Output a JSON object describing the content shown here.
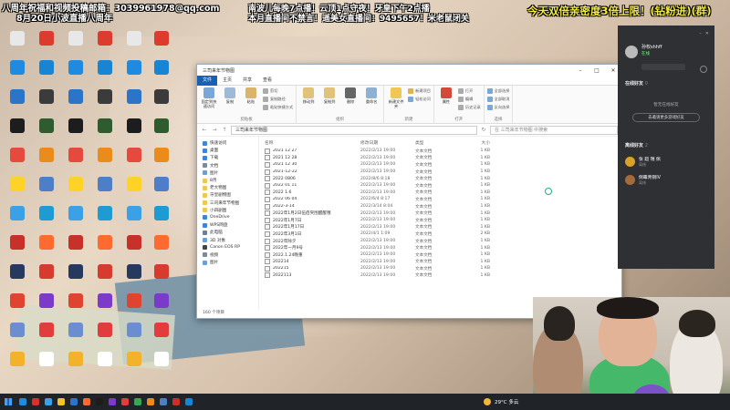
{
  "overlay": {
    "top_left_line1": "八周年祝福和视频投稿邮箱：3039961978@qq.com",
    "top_left_line2": "8月20日小波直播八周年",
    "center_line1": "南波儿每晚7点播！云顶1点守夜！牙皇下午2点播",
    "center_line2": "本月直播间不禁言！遥美女直播间：9495657！米老鼠闭关",
    "top_right": "今天双倍亲密度3倍上限！(钻粉进)(群)"
  },
  "desktop_icons": [
    {
      "label": "",
      "color": "#e8e8e8"
    },
    {
      "label": "",
      "color": "#1e8be0"
    },
    {
      "label": "",
      "color": "#2a74c9"
    },
    {
      "label": "",
      "color": "#1d1d1d"
    },
    {
      "label": "",
      "color": "#e54a3c"
    },
    {
      "label": "",
      "color": "#ffd226"
    },
    {
      "label": "",
      "color": "#3aa0e8"
    },
    {
      "label": "",
      "color": "#c8302a"
    },
    {
      "label": "",
      "color": "#253a5e"
    },
    {
      "label": "",
      "color": "#e0432f"
    },
    {
      "label": "",
      "color": "#6b8ed1"
    },
    {
      "label": "",
      "color": "#f2b22a"
    },
    {
      "label": "",
      "color": "#dd3b2d"
    },
    {
      "label": "",
      "color": "#1785d4"
    },
    {
      "label": "",
      "color": "#3b3b3b"
    },
    {
      "label": "",
      "color": "#2d5c2f"
    },
    {
      "label": "",
      "color": "#ea8c1c"
    },
    {
      "label": "",
      "color": "#4d7ec7"
    },
    {
      "label": "",
      "color": "#1f9bd4"
    },
    {
      "label": "",
      "color": "#ff6a30"
    },
    {
      "label": "",
      "color": "#d63b2d"
    },
    {
      "label": "",
      "color": "#7c3acb"
    },
    {
      "label": "",
      "color": "#e23c3c"
    },
    {
      "label": "",
      "color": "#ffffff"
    }
  ],
  "explorer": {
    "title": "三司来年节物图",
    "tabs": [
      "文件",
      "主页",
      "共享",
      "查看"
    ],
    "ribbon": {
      "clipboard": {
        "label": "剪贴板",
        "pin": "固定到快速访问",
        "copy": "复制",
        "paste": "粘贴",
        "cut": "剪切",
        "copy_path": "复制路径",
        "paste_shortcut": "粘贴快捷方式"
      },
      "organize": {
        "label": "组织",
        "move_to": "移动到",
        "copy_to": "复制到",
        "delete": "删除",
        "rename": "重命名"
      },
      "new": {
        "label": "新建",
        "new_folder": "新建文件夹",
        "new_item": "新建项目",
        "easy_access": "轻松访问"
      },
      "open": {
        "label": "打开",
        "properties": "属性",
        "open": "打开",
        "edit": "编辑",
        "history": "历史记录"
      },
      "select": {
        "label": "选择",
        "select_all": "全部选择",
        "select_none": "全部取消",
        "invert": "反向选择"
      }
    },
    "address": "三司来年节物图",
    "search_placeholder": "在 三司来年节物图 中搜索",
    "nav_items": [
      "快速访问",
      "桌面",
      "下载",
      "文档",
      "图片",
      "8月",
      "老大物图",
      "牙皇剧物图",
      "三司来年节物图",
      "小四剧图",
      "OneDrive",
      "WPS网盘",
      "此电脑",
      "3D 对象",
      "Canon EOS RP",
      "视频",
      "图片"
    ],
    "columns": {
      "name": "名称",
      "date": "修改日期",
      "type": "类型",
      "size": "大小"
    },
    "files": [
      {
        "name": "2021 12 27",
        "date": "2022/2/13 19:00",
        "type": "文本文档",
        "size": "1 KB"
      },
      {
        "name": "2021 12 28",
        "date": "2022/2/13 19:00",
        "type": "文本文档",
        "size": "1 KB"
      },
      {
        "name": "2021 12 30",
        "date": "2022/2/13 19:00",
        "type": "文本文档",
        "size": "1 KB"
      },
      {
        "name": "2021-12-22",
        "date": "2022/2/13 19:00",
        "type": "文本文档",
        "size": "1 KB"
      },
      {
        "name": "2022 0806",
        "date": "2022/8/6 8:18",
        "type": "文本文档",
        "size": "1 KB"
      },
      {
        "name": "2022 01 11",
        "date": "2022/2/13 19:00",
        "type": "文本文档",
        "size": "1 KB"
      },
      {
        "name": "2022 1.6",
        "date": "2022/2/13 19:00",
        "type": "文本文档",
        "size": "1 KB"
      },
      {
        "name": "2022 06 04",
        "date": "2022/6/4 8:17",
        "type": "文本文档",
        "size": "1 KB"
      },
      {
        "name": "2022-3-14",
        "date": "2022/3/14 8:04",
        "type": "文本文档",
        "size": "1 KB"
      },
      {
        "name": "2022年1月2日伍佰突围醒醒哦",
        "date": "2022/2/13 19:00",
        "type": "文本文档",
        "size": "1 KB"
      },
      {
        "name": "2022年1月7日",
        "date": "2022/2/13 19:00",
        "type": "文本文档",
        "size": "1 KB"
      },
      {
        "name": "2022年1月17日",
        "date": "2022/2/13 19:00",
        "type": "文本文档",
        "size": "1 KB"
      },
      {
        "name": "2022年3月1日",
        "date": "2022/4/1 1:09",
        "type": "文本文档",
        "size": "2 KB"
      },
      {
        "name": "2022年除夕",
        "date": "2022/2/13 19:00",
        "type": "文本文档",
        "size": "1 KB"
      },
      {
        "name": "2022年一月9号",
        "date": "2022/2/13 19:00",
        "type": "文本文档",
        "size": "1 KB"
      },
      {
        "name": "2022.1.24晚重",
        "date": "2022/2/13 19:00",
        "type": "文本文档",
        "size": "1 KB"
      },
      {
        "name": "202214",
        "date": "2022/2/13 19:00",
        "type": "文本文档",
        "size": "1 KB"
      },
      {
        "name": "202215",
        "date": "2022/2/13 19:00",
        "type": "文本文档",
        "size": "1 KB"
      },
      {
        "name": "2022113",
        "date": "2022/2/13 19:00",
        "type": "文本文档",
        "size": "1 KB"
      }
    ],
    "status": "160 个项目"
  },
  "friend_panel": {
    "user_name": "孙权shhff",
    "user_status": "在线",
    "online_section": "在线好友",
    "online_count": "0",
    "empty_text": "暂无在线好友",
    "invite_label": "去邀请更多游戏好友",
    "offline_section": "离线好友",
    "offline_count": "2",
    "friends": [
      {
        "name": "张 超 瑞 佩",
        "status": "离线",
        "color": "#d9a227"
      },
      {
        "name": "倒霉青铜IV",
        "status": "离线",
        "color": "#a56b3b"
      }
    ]
  },
  "taskbar": {
    "weather": "29°C 多云",
    "time": "",
    "apps": [
      "#1e8be0",
      "#d8302a",
      "#3aa0e8",
      "#f2c12e",
      "#2a74c9",
      "#ff6a30",
      "#1d1d1d",
      "#7c3acb",
      "#e23c3c",
      "#34a853",
      "#ea8c1c",
      "#4d7ec7",
      "#c8302a",
      "#1785d4"
    ]
  }
}
